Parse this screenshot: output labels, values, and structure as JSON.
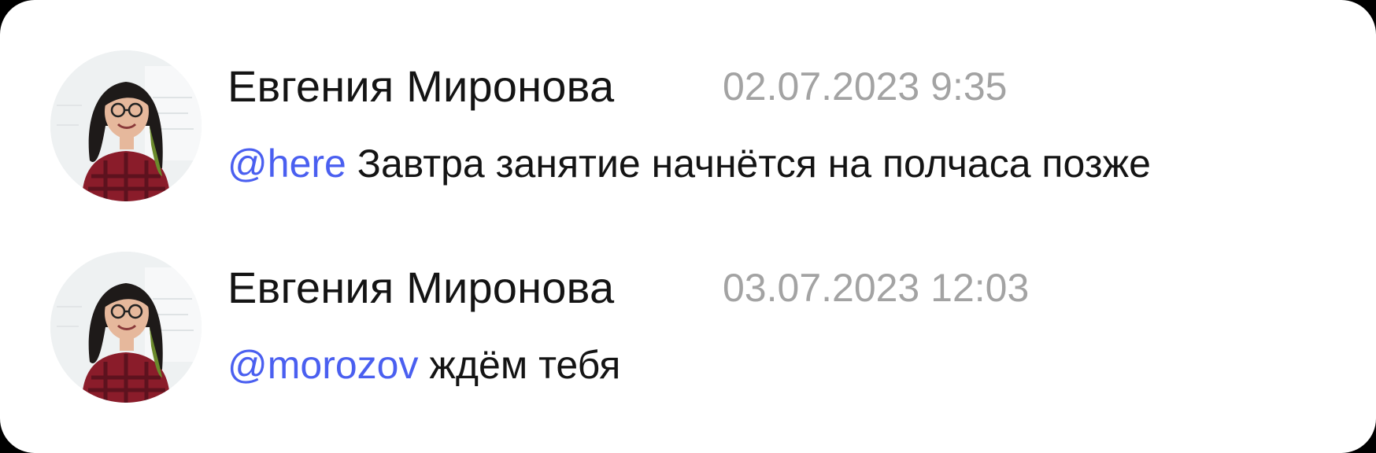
{
  "colors": {
    "background": "#ffffff",
    "text": "#141414",
    "timestamp": "#a3a3a3",
    "mention": "#4a5ff0"
  },
  "messages": [
    {
      "author": "Евгения Миронова",
      "timestamp": "02.07.2023 9:35",
      "mention": "@here",
      "text": "Завтра занятие начнётся на полчаса позже",
      "avatar_icon": "user-photo"
    },
    {
      "author": "Евгения Миронова",
      "timestamp": "03.07.2023 12:03",
      "mention": "@morozov",
      "text": "ждём тебя",
      "avatar_icon": "user-photo"
    }
  ]
}
